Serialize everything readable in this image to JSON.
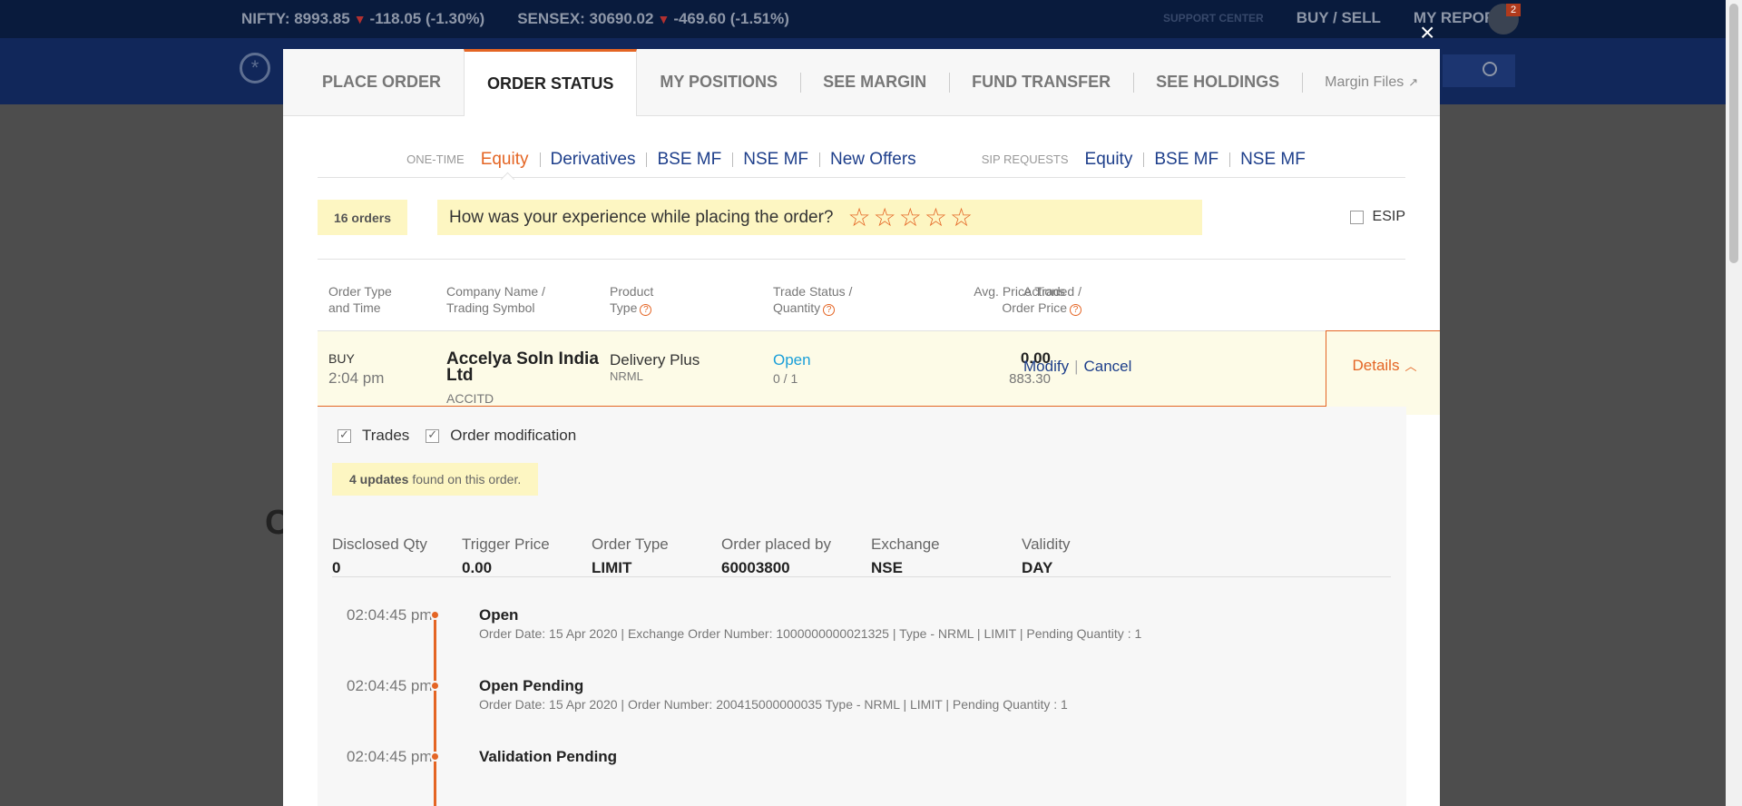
{
  "background": {
    "ticker": {
      "nifty_label": "NIFTY: 8993.85",
      "nifty_change": "-118.05 (-1.30%)",
      "sensex_label": "SENSEX: 30690.02",
      "sensex_change": "-469.60 (-1.51%)"
    },
    "support_center": "SUPPORT CENTER",
    "buy_sell": "BUY / SELL",
    "my_reports": "MY REPORTS",
    "notification_count": "2",
    "page_letter": "C"
  },
  "modal": {
    "close_label": "×",
    "tabs": [
      {
        "label": "PLACE ORDER"
      },
      {
        "label": "ORDER STATUS"
      },
      {
        "label": "MY POSITIONS"
      },
      {
        "label": "SEE MARGIN"
      },
      {
        "label": "FUND TRANSFER"
      },
      {
        "label": "SEE HOLDINGS"
      },
      {
        "label": "Margin Files"
      }
    ],
    "subnav": {
      "one_time_label": "ONE-TIME",
      "one_time": [
        "Equity",
        "Derivatives",
        "BSE MF",
        "NSE MF",
        "New Offers"
      ],
      "sip_label": "SIP REQUESTS",
      "sip": [
        "Equity",
        "BSE MF",
        "NSE MF"
      ]
    },
    "orders_count": "16 orders",
    "feedback_question": "How was your experience while placing the order?",
    "esip_label": "ESIP",
    "columns": {
      "order_type_1": "Order Type",
      "order_type_2": "and Time",
      "company_1": "Company Name /",
      "company_2": "Trading Symbol",
      "product_1": "Product",
      "product_2": "Type",
      "trade_status_1": "Trade Status /",
      "trade_status_2": "Quantity",
      "avg_price_1": "Avg. Price Traded /",
      "avg_price_2": "Order Price",
      "actions": "Actions"
    },
    "order": {
      "type": "BUY",
      "time": "2:04 pm",
      "company": "Accelya Soln India Ltd",
      "symbol": "ACCITD",
      "product": "Delivery Plus",
      "product_sub": "NRML",
      "status": "Open",
      "quantity": "0 / 1",
      "avg_price": "0.00",
      "order_price": "883.30",
      "modify": "Modify",
      "cancel": "Cancel",
      "details": "Details"
    },
    "details": {
      "trades_label": "Trades",
      "order_mod_label": "Order modification",
      "updates_count": "4 updates",
      "updates_suffix": "found on this order.",
      "props": [
        {
          "label": "Disclosed Qty",
          "value": "0"
        },
        {
          "label": "Trigger Price",
          "value": "0.00"
        },
        {
          "label": "Order Type",
          "value": "LIMIT"
        },
        {
          "label": "Order placed by",
          "value": "60003800"
        },
        {
          "label": "Exchange",
          "value": "NSE"
        },
        {
          "label": "Validity",
          "value": "DAY"
        }
      ],
      "timeline": [
        {
          "time": "02:04:45 pm",
          "title": "Open",
          "desc": "Order Date: 15 Apr 2020 | Exchange Order Number: 1000000000021325 | Type - NRML | LIMIT | Pending Quantity : 1"
        },
        {
          "time": "02:04:45 pm",
          "title": "Open Pending",
          "desc": "Order Date: 15 Apr 2020 | Order Number: 200415000000035 Type - NRML | LIMIT | Pending Quantity : 1"
        },
        {
          "time": "02:04:45 pm",
          "title": "Validation Pending",
          "desc": ""
        }
      ]
    }
  },
  "colors": {
    "accent": "#e46524",
    "link": "#1e3f8b",
    "status_open": "#1a9fd9",
    "highlight": "#fdf6c2"
  }
}
